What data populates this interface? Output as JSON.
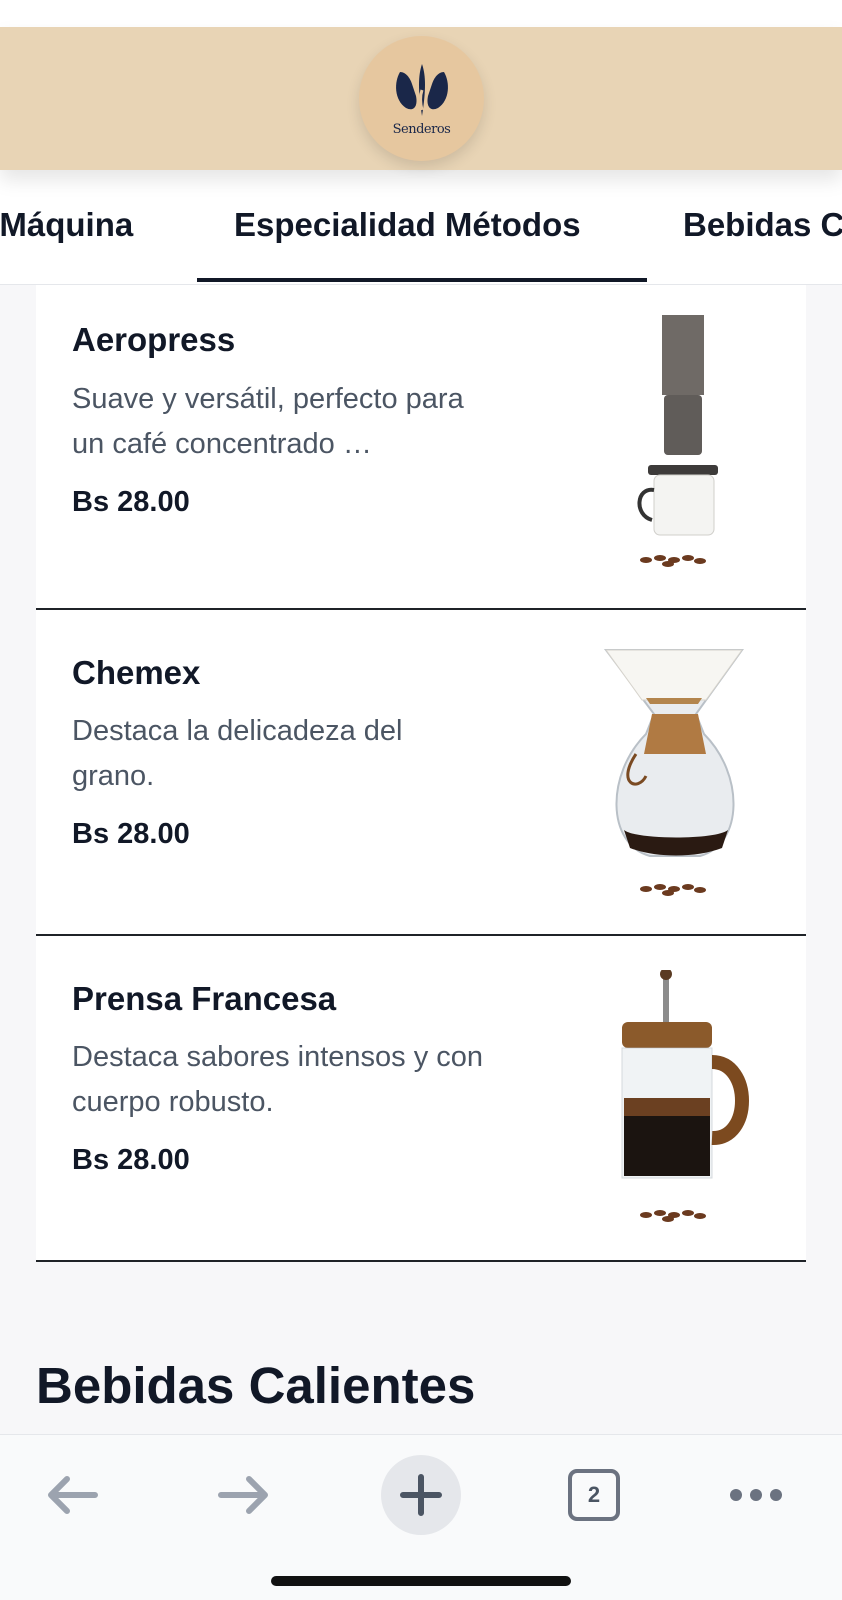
{
  "brand": {
    "logo_text": "Senderos",
    "colors": {
      "header": "#e8d4b5",
      "logo_bg": "#e6c79f",
      "logo_mark": "#1a2749"
    }
  },
  "tabs": [
    {
      "label": "Café de Máquina",
      "active": false
    },
    {
      "label": "Especialidad Métodos",
      "active": true
    },
    {
      "label": "Bebidas Calientes",
      "active": false
    }
  ],
  "products": [
    {
      "name": "Aeropress",
      "description": "Suave y versátil, perfecto para un café concentrado …",
      "price": "Bs 28.00",
      "image": "aeropress"
    },
    {
      "name": "Chemex",
      "description": "Destaca la delicadeza del grano.",
      "price": "Bs 28.00",
      "image": "chemex"
    },
    {
      "name": "Prensa Francesa",
      "description": "Destaca sabores intensos y con cuerpo robusto.",
      "price": "Bs 28.00",
      "image": "french-press"
    }
  ],
  "next_section": {
    "title": "Bebidas Calientes"
  },
  "browser_toolbar": {
    "back_icon": "arrow-left-icon",
    "forward_icon": "arrow-right-icon",
    "new_tab_icon": "plus-icon",
    "tab_count": "2",
    "menu_icon": "more-dots-icon"
  }
}
